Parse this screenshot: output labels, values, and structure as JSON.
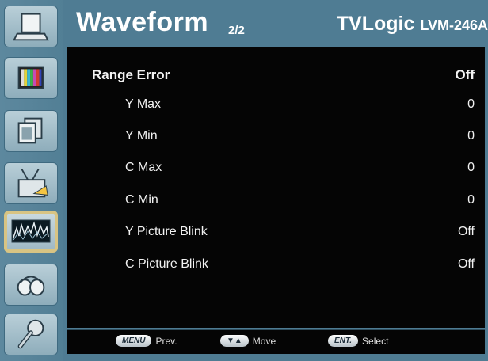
{
  "header": {
    "title": "Waveform",
    "page_indicator": "2/2",
    "brand": "TVLogic",
    "model": "LVM-246A"
  },
  "sidebar": {
    "items": [
      {
        "name": "display-icon"
      },
      {
        "name": "color-bars-icon"
      },
      {
        "name": "multi-screen-icon"
      },
      {
        "name": "satellite-tv-icon"
      },
      {
        "name": "waveform-icon",
        "active": true
      },
      {
        "name": "audio-icon"
      },
      {
        "name": "tools-icon"
      }
    ]
  },
  "menu": {
    "rows": [
      {
        "label": "Range Error",
        "value": "Off"
      },
      {
        "label": "Y Max",
        "value": "0"
      },
      {
        "label": "Y Min",
        "value": "0"
      },
      {
        "label": "C Max",
        "value": "0"
      },
      {
        "label": "C Min",
        "value": "0"
      },
      {
        "label": "Y Picture Blink",
        "value": "Off"
      },
      {
        "label": "C Picture Blink",
        "value": "Off"
      }
    ]
  },
  "footer": {
    "menu_key": "MENU",
    "menu_text": "Prev.",
    "move_key": "▼▲",
    "move_text": "Move",
    "enter_key": "ENT.",
    "enter_text": "Select"
  }
}
